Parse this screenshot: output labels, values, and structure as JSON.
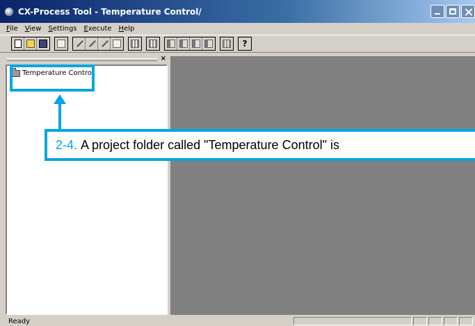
{
  "window": {
    "title": "CX-Process Tool - Temperature Control/"
  },
  "menu": {
    "items": [
      {
        "key": "F",
        "rest": "ile"
      },
      {
        "key": "V",
        "rest": "iew"
      },
      {
        "key": "S",
        "rest": "ettings"
      },
      {
        "key": "E",
        "rest": "xecute"
      },
      {
        "key": "H",
        "rest": "elp"
      }
    ]
  },
  "panel": {
    "close_glyph": "×",
    "tree_item_label": "Temperature Control"
  },
  "status": {
    "text": "Ready"
  },
  "annotation": {
    "step": "2-4.",
    "text": "A project folder called \"Temperature Control\" is",
    "accent_color": "#00a6e0"
  }
}
